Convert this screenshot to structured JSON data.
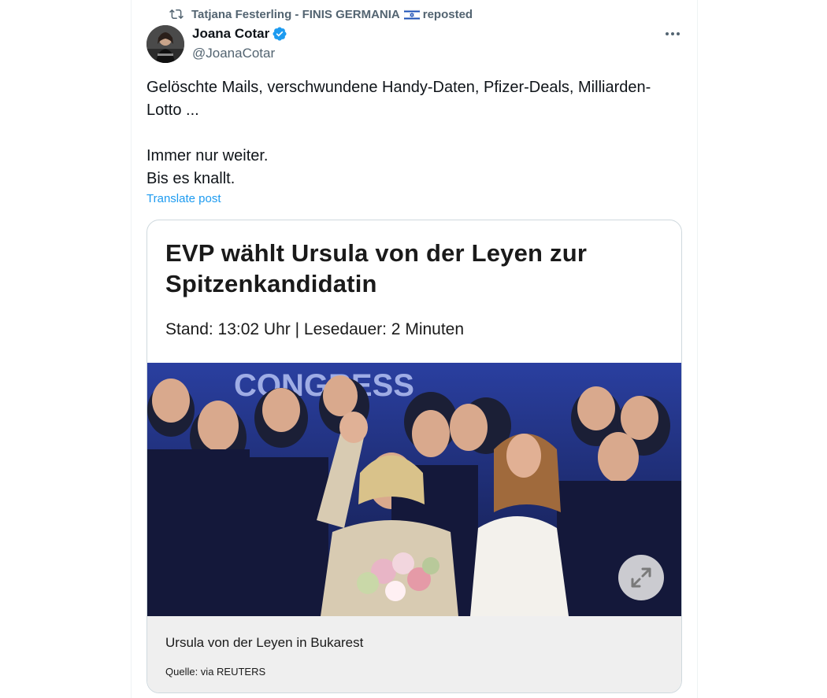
{
  "repost": {
    "icon": "repost-icon",
    "user": "Tatjana Festerling - FINIS GERMANIA",
    "flag_icon": "israel-flag-icon",
    "suffix": "reposted"
  },
  "author": {
    "name": "Joana Cotar",
    "verified_icon": "verified-badge-icon",
    "handle": "@JoanaCotar"
  },
  "more_icon": "more-options-icon",
  "post": {
    "text": "Gelöschte Mails, verschwundene Handy-Daten, Pfizer-Deals, Milliarden-\nLotto ...\n\nImmer nur weiter.\nBis es knallt.",
    "translate_label": "Translate post"
  },
  "card": {
    "headline": "EVP wählt Ursula von der Leyen zur Spitzenkandidatin",
    "meta": "Stand: 13:02 Uhr | Lesedauer: 2 Minuten",
    "image_banner_text": "CONGRESS",
    "expand_icon": "expand-icon",
    "caption": "Ursula von der Leyen in Bukarest",
    "source": "Quelle: via REUTERS"
  },
  "colors": {
    "accent": "#1d9bf0",
    "secondary_text": "#536471",
    "border": "#cfd9de"
  }
}
